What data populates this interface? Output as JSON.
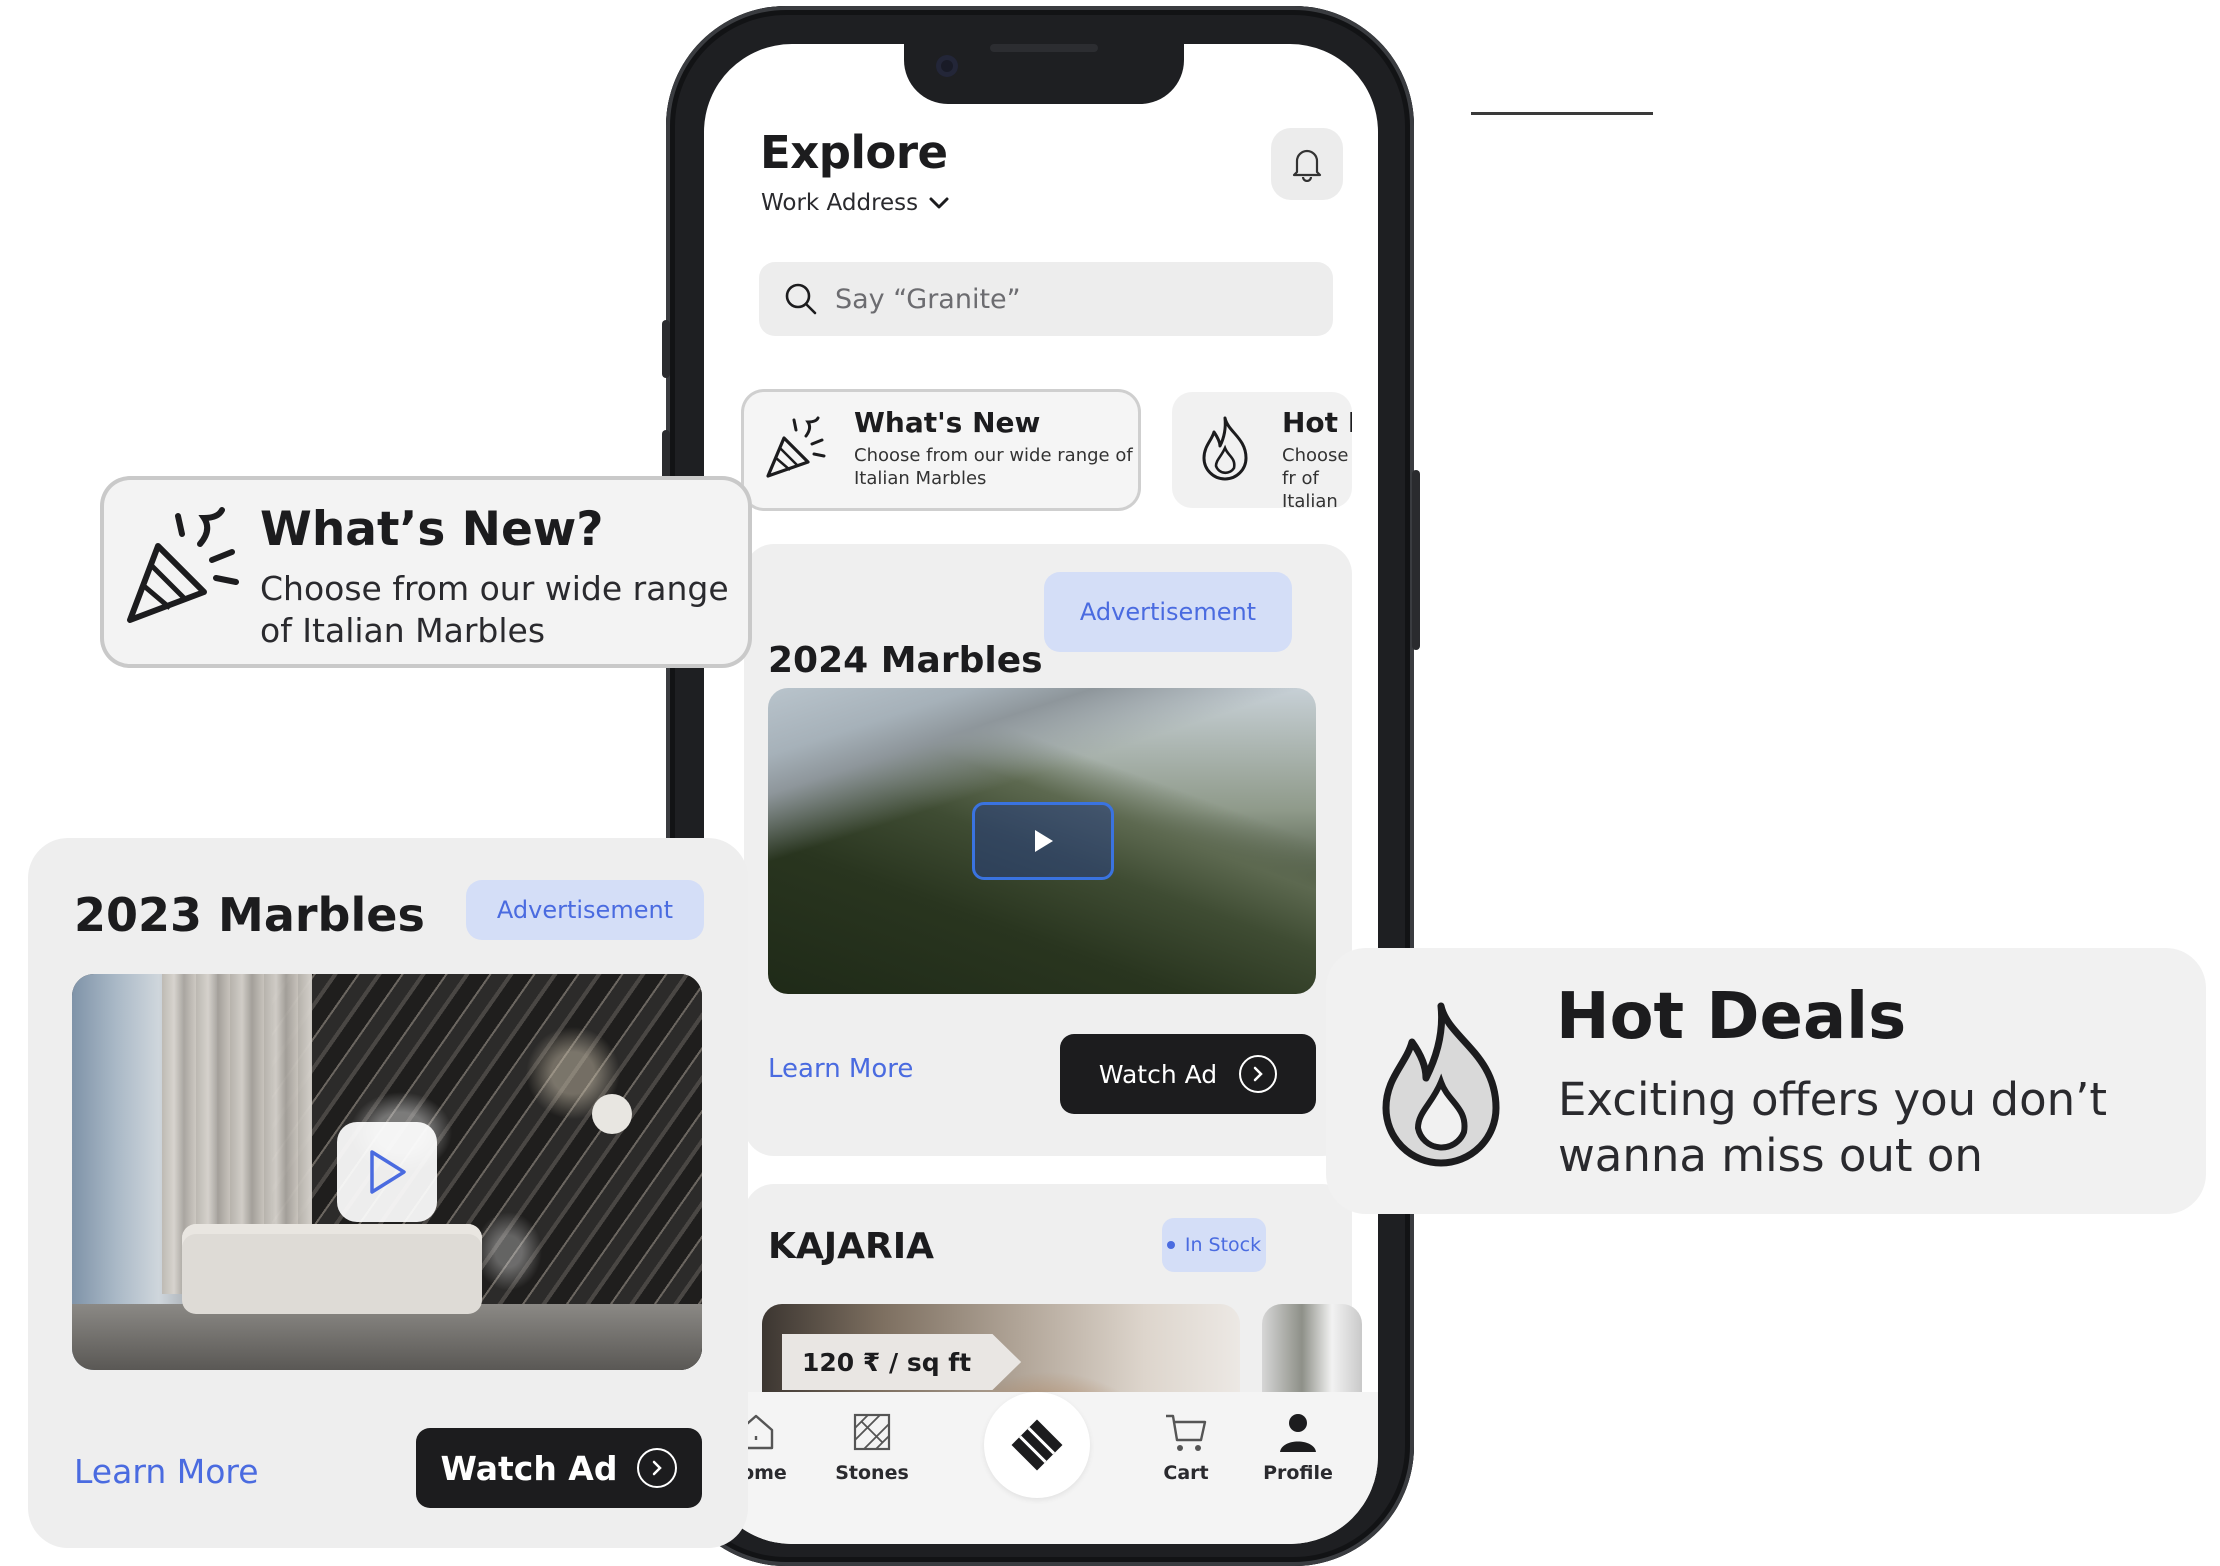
{
  "explore": {
    "title": "Explore",
    "address": "Work Address",
    "search_placeholder": "Say “Granite”"
  },
  "categories": [
    {
      "title": "What's New",
      "desc": "Choose from our wide range of Italian Marbles",
      "icon": "party-popper-icon"
    },
    {
      "title": "Hot D",
      "desc": "Choose fr of Italian",
      "icon": "flame-icon"
    }
  ],
  "featured_2024": {
    "title": "2024 Marbles",
    "badge": "Advertisement",
    "learn_more": "Learn More",
    "watch_ad": "Watch Ad"
  },
  "product": {
    "brand": "KAJARIA",
    "stock": "In Stock",
    "price": "120 ₹ / sq ft"
  },
  "tabbar": [
    {
      "label": "Home",
      "icon": "home-icon"
    },
    {
      "label": "Stones",
      "icon": "stones-icon"
    },
    {
      "label": "",
      "icon": "center-logo-icon"
    },
    {
      "label": "Cart",
      "icon": "cart-icon"
    },
    {
      "label": "Profile",
      "icon": "profile-icon"
    }
  ],
  "float_whats_new": {
    "title": "What’s New?",
    "desc": "Choose from our wide range of Italian Marbles"
  },
  "featured_2023": {
    "title": "2023 Marbles",
    "badge": "Advertisement",
    "learn_more": "Learn More",
    "watch_ad": "Watch Ad"
  },
  "float_hot_deals": {
    "title": "Hot Deals",
    "desc": "Exciting offers you don’t wanna miss out on"
  },
  "colors": {
    "accent": "#4a6be0",
    "badge_bg": "#d4def7",
    "dark": "#1c1c1e",
    "card_bg": "#efefef"
  }
}
